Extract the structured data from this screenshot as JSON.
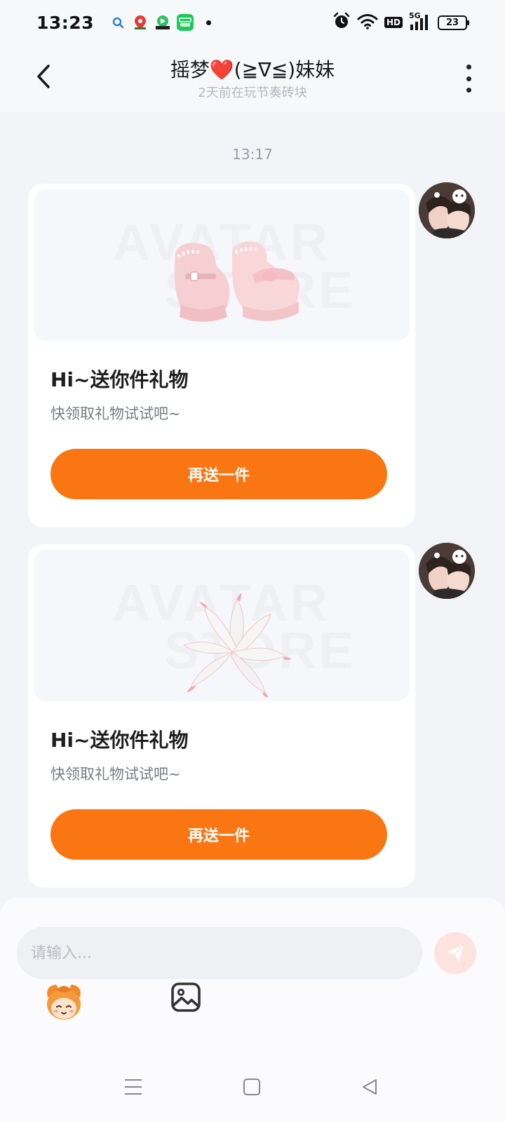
{
  "status_bar": {
    "time": "13:23",
    "network": "5G",
    "hd": "HD",
    "battery": "23",
    "icons": [
      "search-app-icon",
      "map-app-icon",
      "video-app-icon",
      "iqiyi-app-icon",
      "alarm-icon",
      "wifi-icon",
      "signal-icon",
      "battery-icon"
    ]
  },
  "header": {
    "title": "摇梦❤️(≧∇≦)妹妹",
    "subtitle": "2天前在玩节奏砖块"
  },
  "chat": {
    "timestamp": "13:17",
    "messages": [
      {
        "watermark_line1": "AVATAR",
        "watermark_line2": "STORE",
        "gift": "pink-platform-shoes",
        "title": "Hi~送你件礼物",
        "description": "快领取礼物试试吧~",
        "button": "再送一件"
      },
      {
        "watermark_line1": "AVATAR",
        "watermark_line2": "STORE",
        "gift": "white-fox-tails",
        "title": "Hi~送你件礼物",
        "description": "快领取礼物试试吧~",
        "button": "再送一件"
      }
    ]
  },
  "composer": {
    "placeholder": "请输入..."
  },
  "colors": {
    "accent": "#fa7613",
    "send_disabled": "#fde3df",
    "background": "#f2f4f7"
  }
}
